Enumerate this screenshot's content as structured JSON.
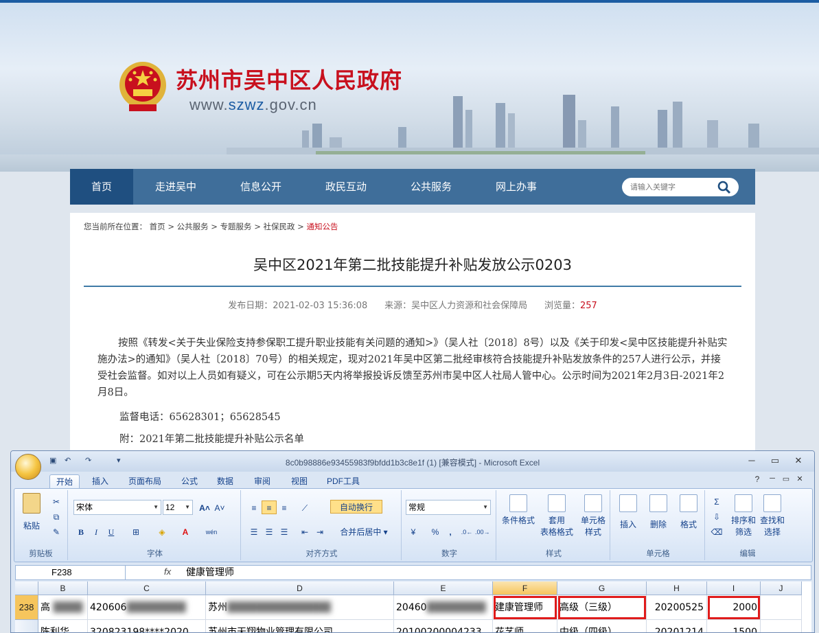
{
  "site": {
    "title": "苏州市吴中区人民政府",
    "url_prefix": "www.",
    "url_domain": "szwz",
    "url_suffix": ".gov.cn"
  },
  "nav": {
    "items": [
      {
        "label": "首页",
        "active": true
      },
      {
        "label": "走进吴中"
      },
      {
        "label": "信息公开"
      },
      {
        "label": "政民互动"
      },
      {
        "label": "公共服务"
      },
      {
        "label": "网上办事"
      }
    ],
    "search_placeholder": "请输入关键字"
  },
  "breadcrumb": {
    "prefix": "您当前所在位置：",
    "items": [
      "首页",
      "公共服务",
      "专题服务",
      "社保民政",
      "通知公告"
    ],
    "sep": " > "
  },
  "article": {
    "title": "吴中区2021年第二批技能提升补贴发放公示0203",
    "date_label": "发布日期：",
    "date": "2021-02-03 15:36:08",
    "source_label": "来源：",
    "source": "吴中区人力资源和社会保障局",
    "views_label": "浏览量：",
    "views": "257",
    "paragraph": "按照《转发<关于失业保险支持参保职工提升职业技能有关问题的通知>》（吴人社〔2018〕8号）以及《关于印发<吴中区技能提升补贴实施办法>的通知》（吴人社〔2018〕70号）的相关规定，现对2021年吴中区第二批经审核符合技能提升补贴发放条件的257人进行公示，并接受社会监督。如对以上人员如有疑义，可在公示期5天内将举报投诉反馈至苏州市吴中区人社局人管中心。公示时间为2021年2月3日-2021年2月8日。",
    "phone": "监督电话：65628301；65628545",
    "attachment": "附：2021年第二批技能提升补贴公示名单"
  },
  "excel": {
    "title": "8c0b98886e93455983f9bfdd1b3c8e1f (1)  [兼容模式] - Microsoft Excel",
    "tabs": [
      {
        "label": "开始",
        "active": true
      },
      {
        "label": "插入"
      },
      {
        "label": "页面布局"
      },
      {
        "label": "公式"
      },
      {
        "label": "数据"
      },
      {
        "label": "审阅"
      },
      {
        "label": "视图"
      },
      {
        "label": "PDF工具"
      }
    ],
    "groups": {
      "clipboard": "剪贴板",
      "font": "字体",
      "alignment": "对齐方式",
      "number": "数字",
      "styles": "样式",
      "cells": "单元格",
      "editing": "编辑"
    },
    "buttons": {
      "paste": "粘贴",
      "wrap_text": "自动换行",
      "merge_center": "合并后居中",
      "cond_format": "条件格式",
      "format_table_1": "套用",
      "format_table_2": "表格格式",
      "cell_style_1": "单元格",
      "cell_style_2": "样式",
      "insert": "插入",
      "delete": "删除",
      "format": "格式",
      "sort_1": "排序和",
      "sort_2": "筛选",
      "find_1": "查找和",
      "find_2": "选择",
      "bold": "B",
      "italic": "I",
      "underline": "U",
      "font_color": "A",
      "wen": "wén",
      "percent": "%",
      "comma": ","
    },
    "font_name": "宋体",
    "font_size": "12",
    "number_format": "常规",
    "name_box": "F238",
    "fx": "fx",
    "formula": "健康管理师",
    "columns": [
      "B",
      "C",
      "D",
      "E",
      "F",
      "G",
      "H",
      "I",
      "J"
    ],
    "rows": [
      {
        "num": "238",
        "cells": [
          "高",
          "420606",
          "苏州",
          "20460",
          "建康管理师",
          "高级（三级）",
          "20200525",
          "2000",
          ""
        ]
      },
      {
        "num": "",
        "cells": [
          "陈利华",
          "320823198****2020",
          "苏州市天翔物业管理有限公司",
          "20100200004233",
          "花艺师",
          "中级（四级）",
          "20201214",
          "1500",
          ""
        ]
      }
    ]
  }
}
